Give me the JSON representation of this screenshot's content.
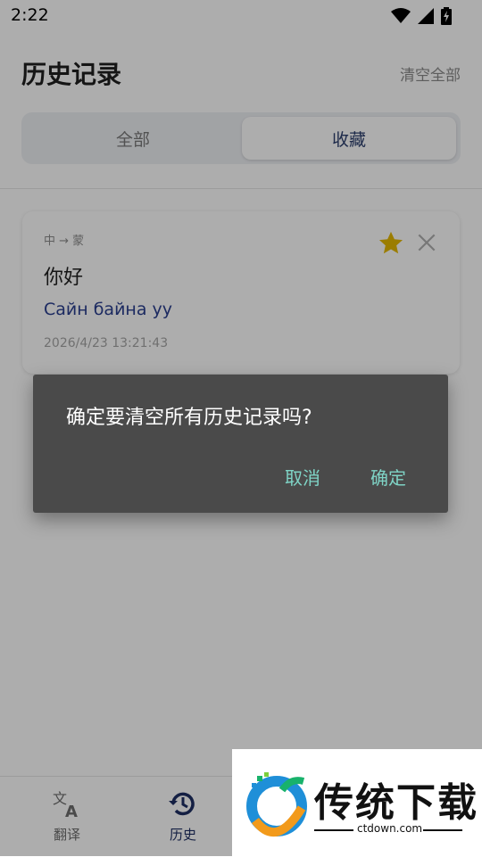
{
  "status_bar": {
    "time": "2:22",
    "icons": [
      "wifi-icon",
      "signal-icon",
      "battery-charging-icon"
    ]
  },
  "header": {
    "title": "历史记录",
    "clear_all": "清空全部"
  },
  "tabs": [
    {
      "label": "全部",
      "selected": false
    },
    {
      "label": "收藏",
      "selected": true
    }
  ],
  "history": [
    {
      "direction": "中 → 蒙",
      "source": "你好",
      "translation": "Сайн байна уу",
      "timestamp": "2026/4/23 13:21:43",
      "favorite": true
    }
  ],
  "bottom_nav": {
    "items": [
      {
        "label": "翻译",
        "icon": "translate-icon",
        "active": false
      },
      {
        "label": "历史",
        "icon": "history-icon",
        "active": true
      }
    ]
  },
  "dialog": {
    "message": "确定要清空所有历史记录吗?",
    "cancel": "取消",
    "confirm": "确定"
  },
  "watermark": {
    "brand": "传统下载",
    "url": "ctdown.com"
  },
  "colors": {
    "accent": "#1e2f63",
    "star": "#e5b800",
    "dialog_bg": "#4a4a4a",
    "dialog_button": "#7fd4c6"
  }
}
